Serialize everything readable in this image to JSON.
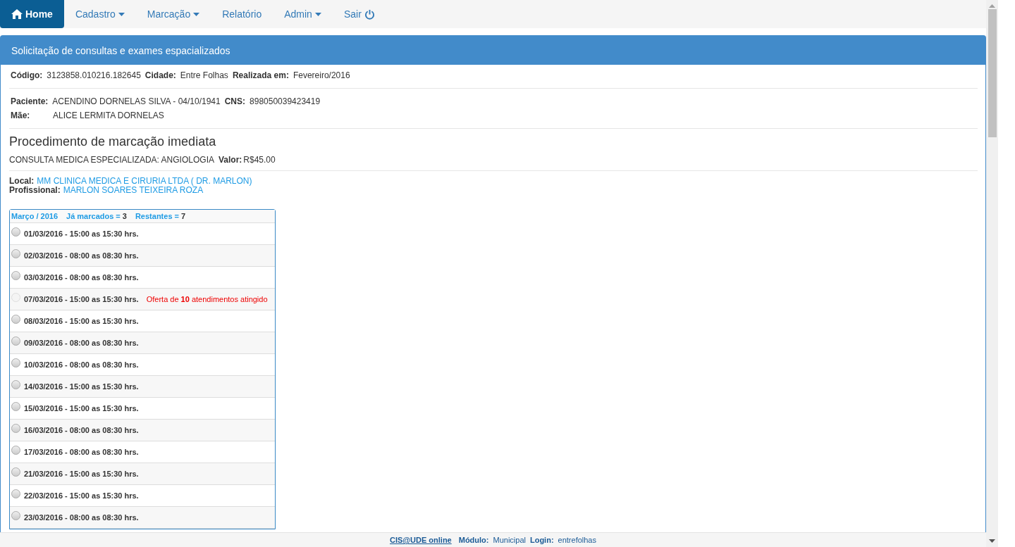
{
  "navbar": {
    "items": [
      {
        "label": "Home",
        "kind": "home",
        "selected": true
      },
      {
        "label": "Cadastro",
        "kind": "dropdown",
        "selected": false
      },
      {
        "label": "Marcação",
        "kind": "dropdown",
        "selected": false
      },
      {
        "label": "Relatório",
        "kind": "link",
        "selected": false
      },
      {
        "label": "Admin",
        "kind": "dropdown",
        "selected": false
      },
      {
        "label": "Sair",
        "kind": "power",
        "selected": false
      }
    ]
  },
  "panel": {
    "title": "Solicitação de consultas e exames espacializados",
    "request": [
      {
        "label": "Código:",
        "value": "3123858.010216.182645"
      },
      {
        "label": "Cidade:",
        "value": "Entre Folhas"
      },
      {
        "label": "Realizada em:",
        "value": "Fevereiro/2016"
      }
    ],
    "patient": [
      {
        "label": "Paciente:",
        "value": "ACENDINO DORNELAS SILVA - 04/10/1941"
      },
      {
        "label": "CNS:",
        "value": "898050039423419"
      }
    ],
    "mother": {
      "label": "Mãe:",
      "value": "ALICE LERMITA DORNELAS"
    },
    "procedure": {
      "heading": "Procedimento de marcação imediata",
      "name": "CONSULTA MEDICA ESPECIALIZADA: ANGIOLOGIA",
      "price_label": "Valor:",
      "price": "R$45.00"
    },
    "location": {
      "label": "Local:",
      "value": "MM CLINICA MEDICA E CIRURIA LTDA ( DR. MARLON)"
    },
    "professional": {
      "label": "Profissional:",
      "value": "MARLON SOARES TEIXEIRA ROZA"
    },
    "schedule": {
      "month": "Março / 2016",
      "booked_label": "Já marcados =",
      "booked": "3",
      "remaining_label": "Restantes =",
      "remaining": "7",
      "slots": [
        {
          "text": "01/03/2016 - 15:00 as 15:30 hrs.",
          "disabled": false
        },
        {
          "text": "02/03/2016 - 08:00 as 08:30 hrs.",
          "disabled": false
        },
        {
          "text": "03/03/2016 - 08:00 as 08:30 hrs.",
          "disabled": false
        },
        {
          "text": "07/03/2016 - 15:00 as 15:30 hrs.",
          "disabled": true,
          "note": "Oferta de **10** atendimentos atingido"
        },
        {
          "text": "08/03/2016 - 15:00 as 15:30 hrs.",
          "disabled": false
        },
        {
          "text": "09/03/2016 - 08:00 as 08:30 hrs.",
          "disabled": false
        },
        {
          "text": "10/03/2016 - 08:00 as 08:30 hrs.",
          "disabled": false
        },
        {
          "text": "14/03/2016 - 15:00 as 15:30 hrs.",
          "disabled": false
        },
        {
          "text": "15/03/2016 - 15:00 as 15:30 hrs.",
          "disabled": false
        },
        {
          "text": "16/03/2016 - 08:00 as 08:30 hrs.",
          "disabled": false
        },
        {
          "text": "17/03/2016 - 08:00 as 08:30 hrs.",
          "disabled": false
        },
        {
          "text": "21/03/2016 - 15:00 as 15:30 hrs.",
          "disabled": false
        },
        {
          "text": "22/03/2016 - 15:00 as 15:30 hrs.",
          "disabled": false
        },
        {
          "text": "23/03/2016 - 08:00 as 08:30 hrs.",
          "disabled": false
        }
      ]
    }
  },
  "footer": {
    "link": "CIS@UDE online",
    "module_label": "Módulo:",
    "module": "Municipal",
    "login_label": "Login:",
    "login": "entrefolhas"
  }
}
